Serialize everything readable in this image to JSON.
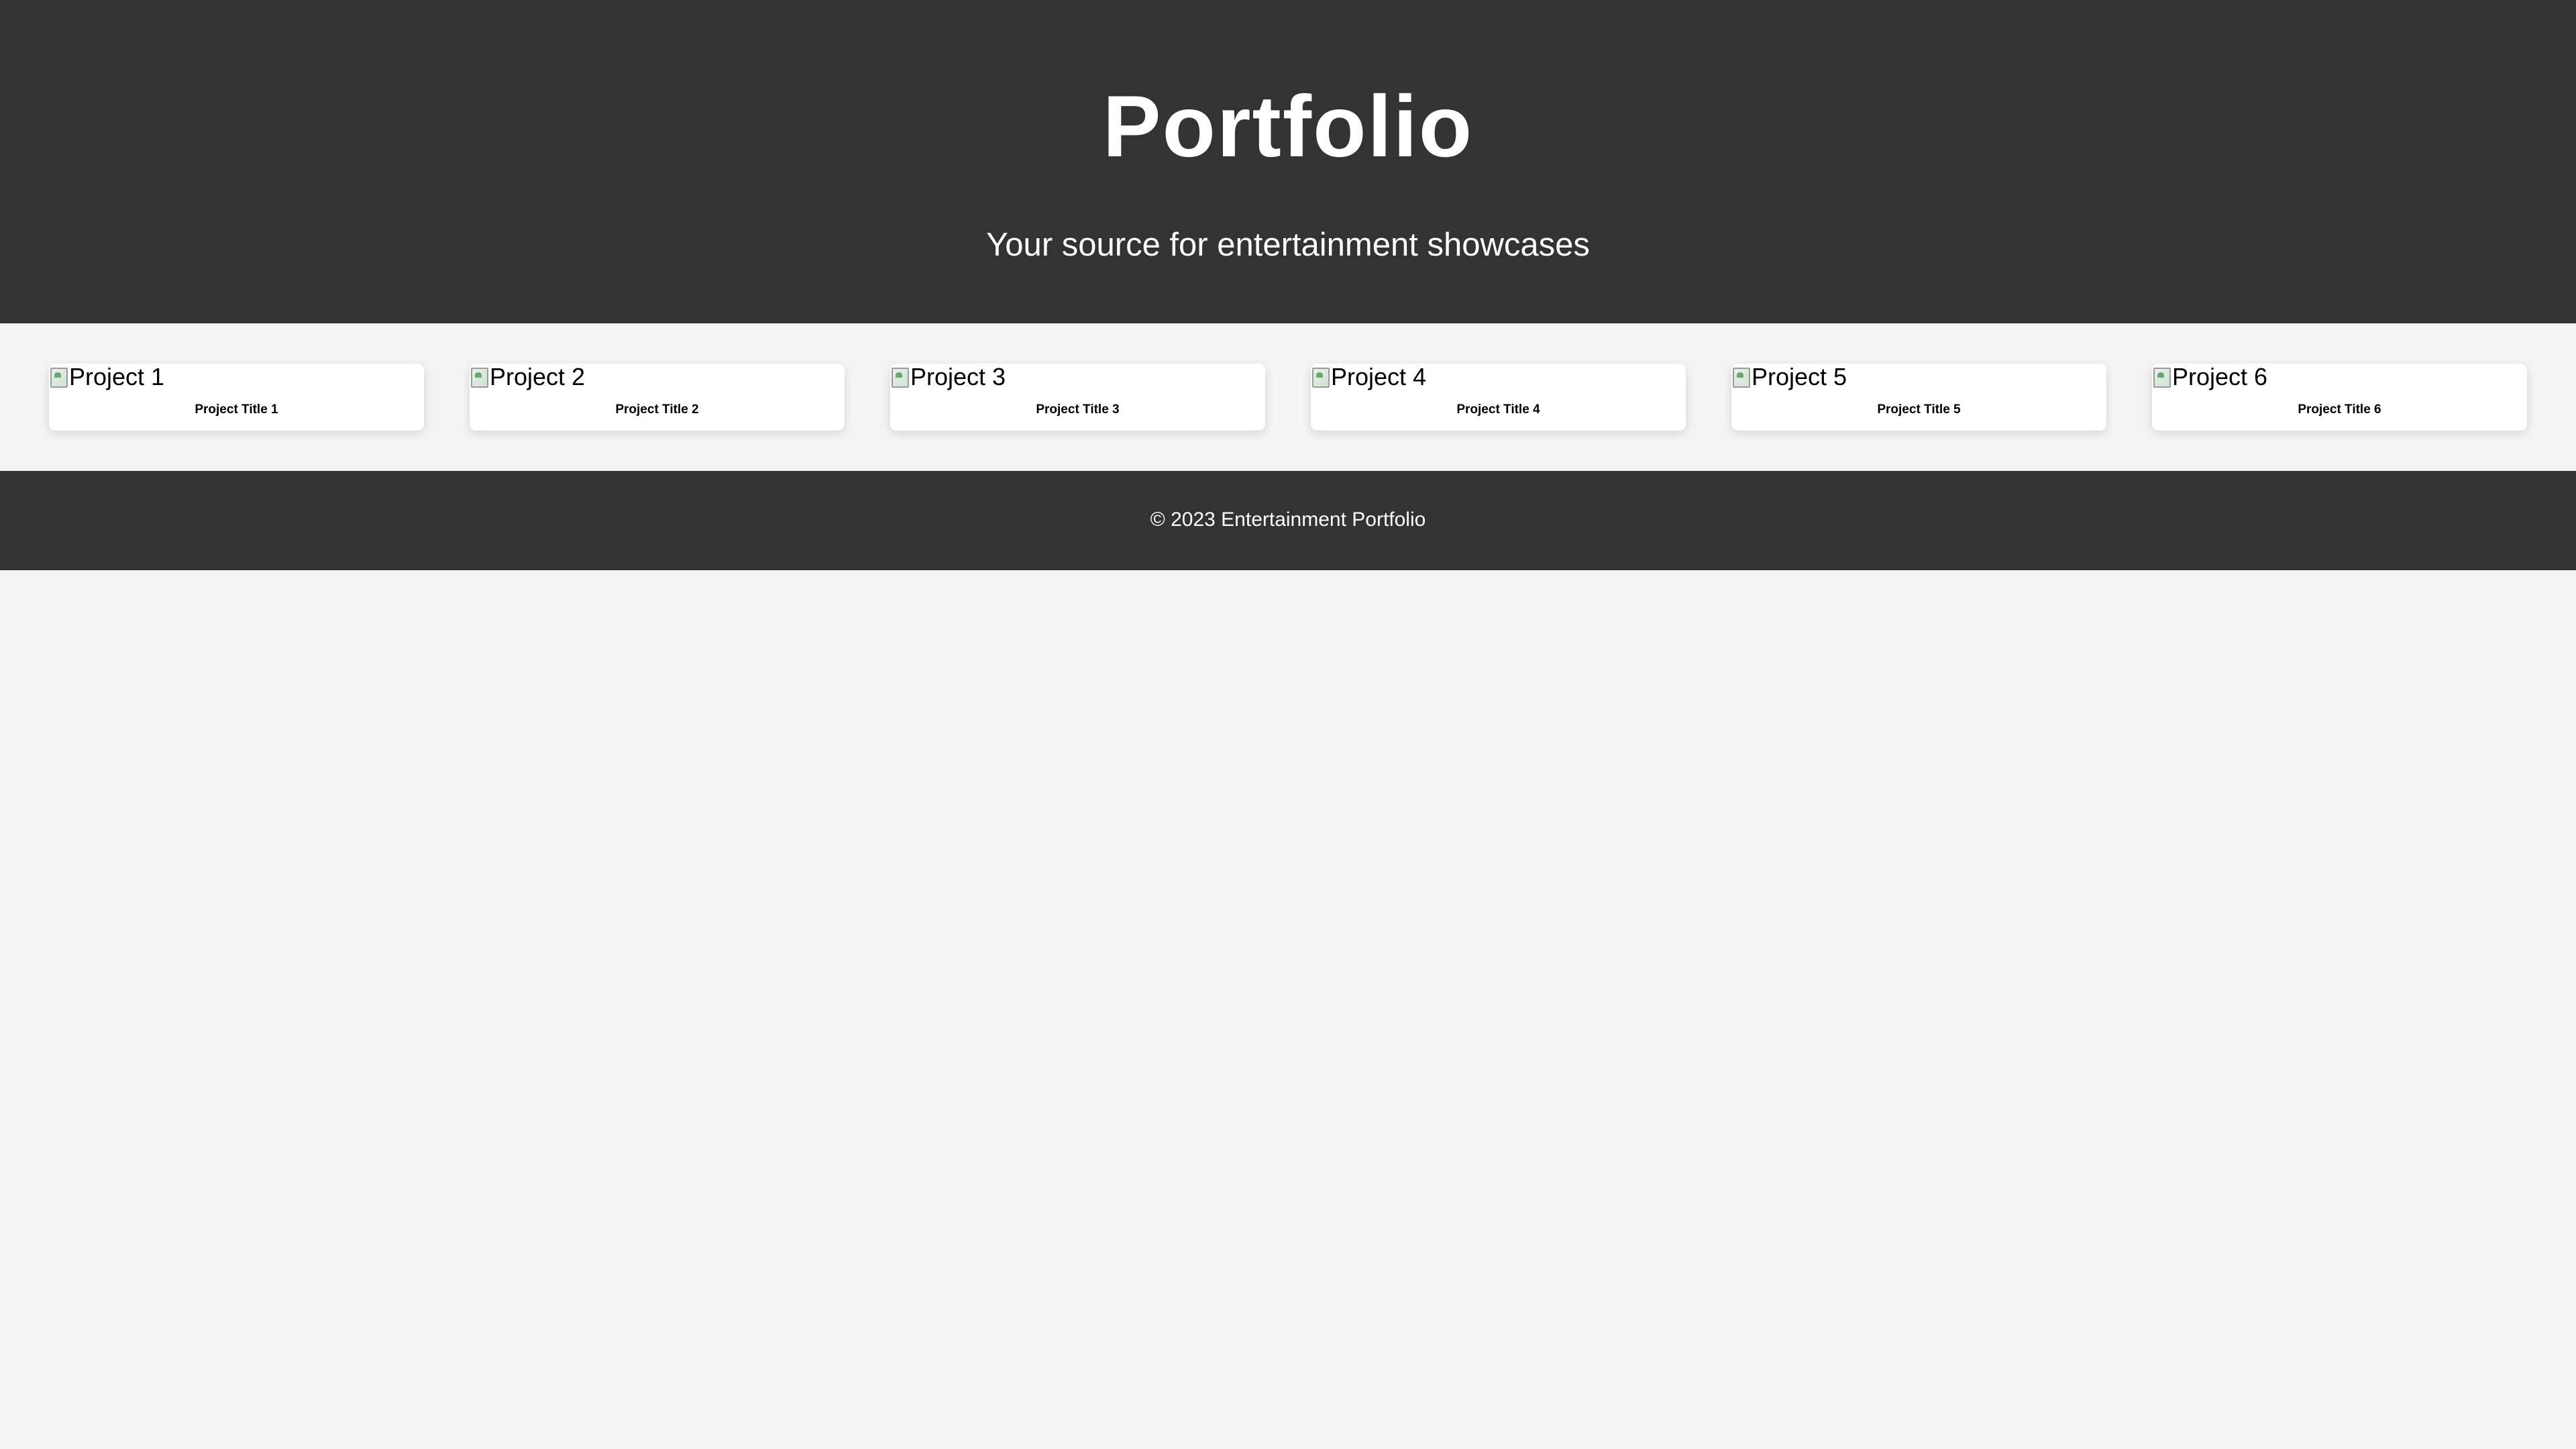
{
  "header": {
    "title": "Portfolio",
    "subtitle": "Your source for entertainment showcases"
  },
  "projects": [
    {
      "image_alt": "Project 1",
      "title": "Project Title 1"
    },
    {
      "image_alt": "Project 2",
      "title": "Project Title 2"
    },
    {
      "image_alt": "Project 3",
      "title": "Project Title 3"
    },
    {
      "image_alt": "Project 4",
      "title": "Project Title 4"
    },
    {
      "image_alt": "Project 5",
      "title": "Project Title 5"
    },
    {
      "image_alt": "Project 6",
      "title": "Project Title 6"
    }
  ],
  "footer": {
    "copyright": "© 2023 Entertainment Portfolio"
  },
  "colors": {
    "header_bg": "#333333",
    "page_bg": "#f4f4f4",
    "card_bg": "#ffffff",
    "text_light": "#ffffff"
  }
}
